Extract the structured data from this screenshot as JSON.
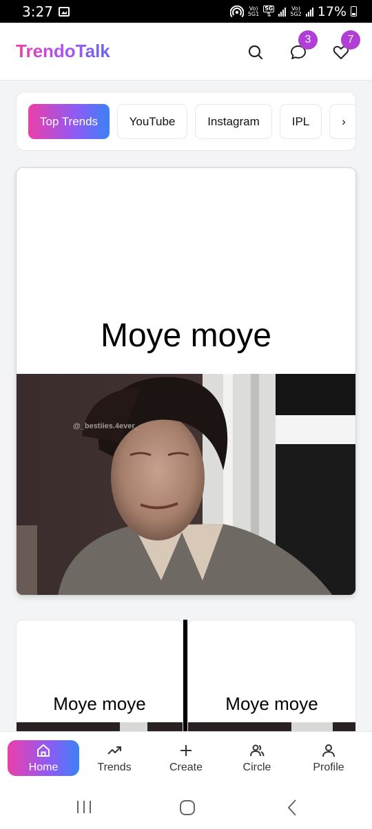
{
  "status_bar": {
    "time": "3:27",
    "net1_top": "Vo)",
    "net1_bottom": "5G1",
    "five_g": "5G",
    "net2_top": "Vo)",
    "net2_bottom": "5G2",
    "battery": "17%"
  },
  "header": {
    "brand": "TrendoTalk",
    "messages_badge": "3",
    "likes_badge": "7"
  },
  "categories": {
    "items": [
      "Top Trends",
      "YouTube",
      "Instagram",
      "IPL"
    ],
    "more": "›",
    "active_index": 0
  },
  "feed": {
    "main_post": {
      "caption": "Moye moye",
      "watermark": "@_bestiies.4ever_"
    },
    "left_post": {
      "caption": "Moye moye"
    },
    "right_post": {
      "caption": "Moye moye"
    }
  },
  "bottom_nav": {
    "home": "Home",
    "trends": "Trends",
    "create": "Create",
    "circle": "Circle",
    "profile": "Profile"
  },
  "colors": {
    "brand_pink": "#ec3fa9",
    "brand_purple": "#8b5cf6",
    "brand_blue": "#3b82f6",
    "badge": "#b03fd6"
  }
}
